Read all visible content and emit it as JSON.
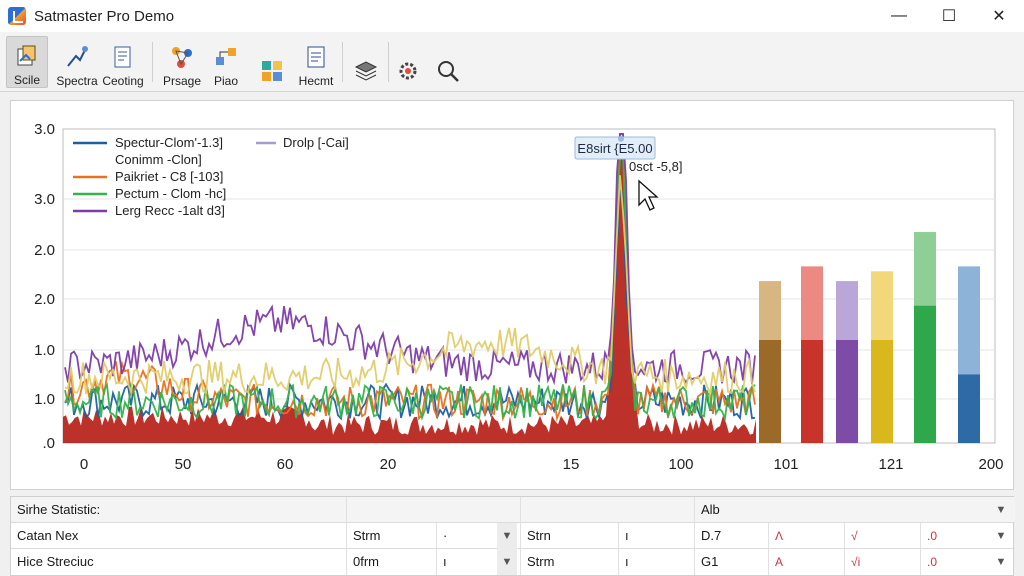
{
  "window": {
    "title": "Satmaster Pro Demo",
    "controls": [
      "—",
      "☐",
      "✕"
    ]
  },
  "toolbar": {
    "items": [
      {
        "label": "Scile",
        "icon": "scale-icon"
      },
      {
        "label": "Spectra",
        "icon": "spectra-icon"
      },
      {
        "label": "Ceoting",
        "icon": "document-icon"
      },
      {
        "label": "Prsage",
        "icon": "network-icon"
      },
      {
        "label": "Piao",
        "icon": "flow-icon"
      },
      {
        "label": "",
        "icon": "grid-icon"
      },
      {
        "label": "Hecmt",
        "icon": "report-icon"
      },
      {
        "label": "",
        "icon": "layers-icon"
      },
      {
        "label": "",
        "icon": "settings-gear-icon"
      },
      {
        "label": "",
        "icon": "search-icon"
      }
    ]
  },
  "chart_data": {
    "type": "line",
    "title": "",
    "xlabel": "",
    "ylabel": "",
    "y_tick_labels": [
      "3.0",
      "3.0",
      "2.0",
      "2.0",
      "1.0",
      "1.0",
      ".0"
    ],
    "x_tick_labels": [
      "0",
      "50",
      "60",
      "20",
      "15",
      "100",
      "101",
      "121",
      "200"
    ],
    "grid": true,
    "legend": {
      "placement": "top-left",
      "entries": [
        {
          "label": "Spectur-Clom'-1.3]",
          "color": "#1f5fa0"
        },
        {
          "label": "Conimm -Clon]",
          "color": "#1f1f1f"
        },
        {
          "label": "Paikriet - C8 [-103]",
          "color": "#e8701e"
        },
        {
          "label": "Pectum - Clom -hc]",
          "color": "#33b34a"
        },
        {
          "label": "Lerg Recc -1alt d3]",
          "color": "#7d3ca8"
        },
        {
          "label": "Drolp [-Cai]",
          "color": "#a79ccc"
        }
      ]
    },
    "peak": {
      "x": 15,
      "y": 3.1,
      "tooltip_title": "E8sirt {E5.00",
      "tooltip_value": "0sct -5,8]"
    },
    "series": [
      {
        "name": "Spectur-Clom'-1.3]",
        "color": "#1f5fa0",
        "peak": 2.15
      },
      {
        "name": "Paikriet - C8 [-103]",
        "color": "#e8701e",
        "peak": 3.0
      },
      {
        "name": "Pectum - Clom -hc]",
        "color": "#33b34a",
        "peak": 2.6
      },
      {
        "name": "Lerg Recc -1alt d3]",
        "color": "#7d3ca8",
        "peak": 2.9
      },
      {
        "name": "Drolp [-Cai]",
        "color": "#e0cc6a",
        "peak": 1.9
      }
    ],
    "bars": {
      "categories": [
        "101",
        "",
        "",
        "121",
        "",
        "200"
      ],
      "stacks": [
        {
          "lower": 1.05,
          "upper": 1.65,
          "lower_color": "#9c6a28",
          "upper_color": "#d8b682"
        },
        {
          "lower": 1.05,
          "upper": 1.8,
          "lower_color": "#c8342b",
          "upper_color": "#ea8a82"
        },
        {
          "lower": 1.05,
          "upper": 1.65,
          "lower_color": "#7d4ca6",
          "upper_color": "#bba6d8"
        },
        {
          "lower": 1.05,
          "upper": 1.75,
          "lower_color": "#d9b81e",
          "upper_color": "#f2d87a"
        },
        {
          "lower": 1.4,
          "upper": 2.15,
          "lower_color": "#2ea84a",
          "upper_color": "#8fcf95"
        },
        {
          "lower": 0.7,
          "upper": 1.8,
          "lower_color": "#2e6aa6",
          "upper_color": "#8db3d8"
        }
      ]
    }
  },
  "stats": {
    "header": {
      "title": "Sirhe Statistic:",
      "col3": "Alb"
    },
    "rows": [
      {
        "name": "Catan Nex",
        "c1": "Strm",
        "c2": "·",
        "c3": "Strn",
        "c4": "ı",
        "c5": "D.7",
        "m1": "Λ",
        "m2": "√",
        "m3": ".0"
      },
      {
        "name": "Hice Streciuc",
        "c1": "0frm",
        "c2": "ı",
        "c3": "Strm",
        "c4": "ı",
        "c5": "G1",
        "m1": "A",
        "m2": "√i",
        "m3": ".0"
      }
    ]
  }
}
